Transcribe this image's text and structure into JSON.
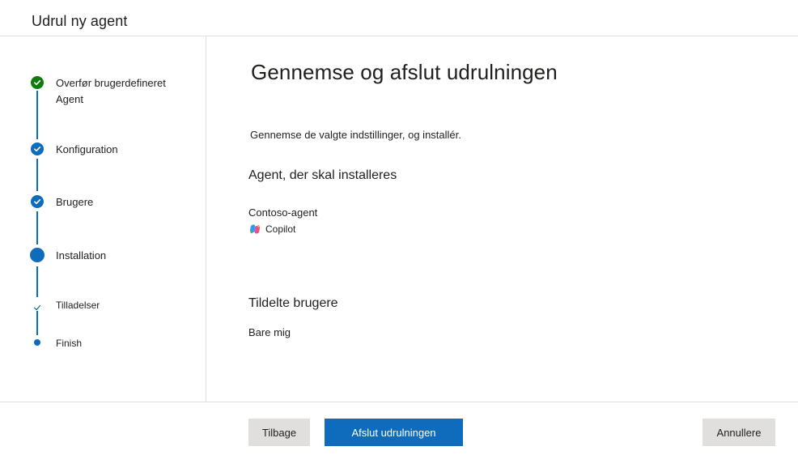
{
  "window": {
    "title": "Udrul ny agent"
  },
  "steps": [
    {
      "label": "Overfør brugerdefineret",
      "label_line2": "Agent",
      "state": "done",
      "color": "#107c10"
    },
    {
      "label": "Konfiguration",
      "state": "done",
      "color": "#0f6cbd"
    },
    {
      "label": "Brugere",
      "state": "done",
      "color": "#0f6cbd"
    },
    {
      "label": "Installation",
      "state": "current",
      "color": "#0f6cbd"
    },
    {
      "label": "Tilladelser",
      "state": "substep-done",
      "color": "#0f6cbd"
    },
    {
      "label": "Finish",
      "state": "substep-pending",
      "color": "#0f6cbd"
    }
  ],
  "main": {
    "title": "Gennemse og afslut udrulningen",
    "intro": "Gennemse de valgte indstillinger, og installér.",
    "agent_section": {
      "heading": "Agent, der skal installeres",
      "agent_name": "Contoso-agent",
      "platform": "Copilot",
      "platform_icon": "copilot-icon"
    },
    "users_section": {
      "heading": "Tildelte brugere",
      "value": "Bare mig"
    }
  },
  "footer": {
    "back_label": "Tilbage",
    "finish_label": "Afslut udrulningen",
    "cancel_label": "Annullere"
  },
  "colors": {
    "accent": "#0f6cbd",
    "success": "#107c10",
    "secondary_button": "#e1dfdd",
    "divider": "#e1dfdd"
  }
}
